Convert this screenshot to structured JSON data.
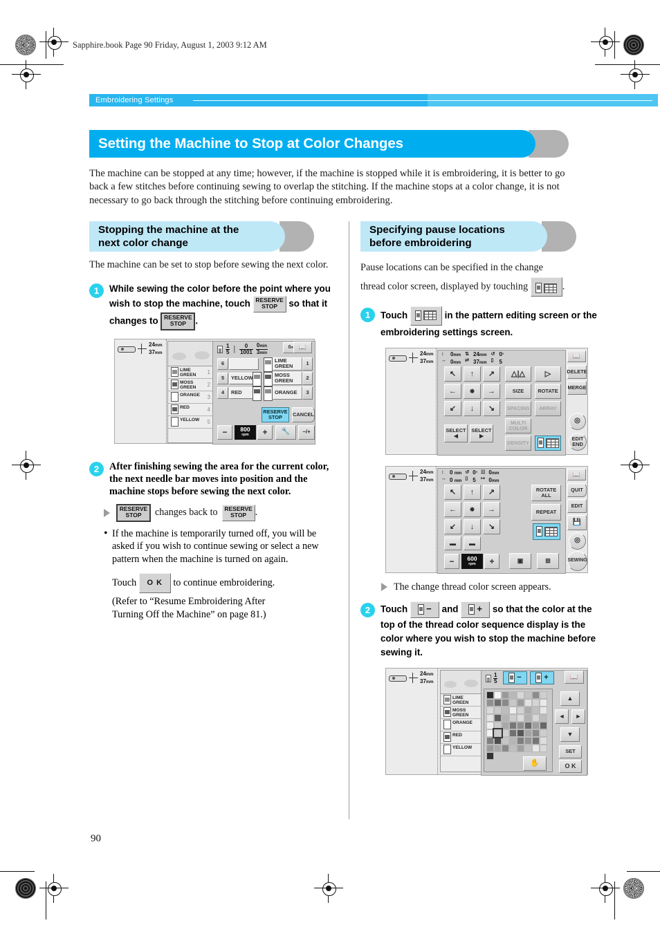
{
  "header": {
    "book_line": "Sapphire.book  Page 90  Friday, August 1, 2003  9:12 AM",
    "running_head": "Embroidering Settings",
    "title": "Setting the Machine to Stop at Color Changes"
  },
  "intro": "The machine can be stopped at any time; however, if the machine is stopped while it is embroidering, it is better to go back a few stitches before continuing sewing to overlap the stitching. If the machine stops at a color change, it is not necessary to go back through the stitching before continuing embroidering.",
  "page_number": "90",
  "left_column": {
    "subhead_line1": "Stopping the machine at the",
    "subhead_line2": "next color change",
    "lead": "The machine can be set to stop before sewing the next color.",
    "step1": {
      "number": "1",
      "text_part1": "While sewing the color before the point where you wish to stop the machine, touch",
      "key_a_line1": "RESERVE",
      "key_a_line2": "STOP",
      "text_part2": "so that it changes to",
      "key_b_line1": "RESERVE",
      "key_b_line2": "STOP",
      "text_part3": "."
    },
    "step2": {
      "number": "2",
      "text": "After finishing sewing the area for the current color, the next needle bar moves into position and the machine stops before sewing the next color.",
      "result_key_line1": "RESERVE",
      "result_key_line2": "STOP",
      "result_text": "changes back to",
      "result_key2_line1": "RESERVE",
      "result_key2_line2": "STOP",
      "result_period": ".",
      "note_bullet": "If the machine is temporarily turned off, you will be asked if you wish to continue sewing or select a new pattern when the machine is turned on again.",
      "touch_prefix": "Touch",
      "ok_label": "O K",
      "touch_suffix": "to continue embroidering.",
      "refer_line1": "(Refer to “Resume Embroidering After",
      "refer_line2": "Turning Off the Machine” on page 81.)"
    },
    "lcd_sewing_screen": {
      "size_w": "24",
      "size_h": "37",
      "unit": "mm",
      "counter_needle_num": "1",
      "counter_needle_den": "5",
      "stitch_current": "0",
      "stitch_total": "1001",
      "time_current": "0",
      "time_total": "3",
      "time_unit": "min",
      "elapsed": "0",
      "elapsed_unit": "min",
      "thread_list": [
        {
          "name_l1": "LIME",
          "name_l2": "GREEN",
          "index": "1"
        },
        {
          "name_l1": "MOSS",
          "name_l2": "GREEN",
          "index": "2"
        },
        {
          "name_l1": "ORANGE",
          "name_l2": "",
          "index": "3"
        },
        {
          "name_l1": "RED",
          "name_l2": "",
          "index": "4"
        },
        {
          "name_l1": "YELLOW",
          "name_l2": "",
          "index": "5"
        }
      ],
      "needle_left": [
        {
          "num": "6",
          "color": ""
        },
        {
          "num": "5",
          "color": "YELLOW"
        },
        {
          "num": "4",
          "color": "RED"
        }
      ],
      "needle_right": [
        {
          "color_l1": "LIME",
          "color_l2": "GREEN",
          "num": "1"
        },
        {
          "color_l1": "MOSS",
          "color_l2": "GREEN",
          "num": "2"
        },
        {
          "color_l1": "ORANGE",
          "color_l2": "",
          "num": "3"
        }
      ],
      "reserve_stop_l1": "RESERVE",
      "reserve_stop_l2": "STOP",
      "cancel": "CANCEL",
      "speed_minus": "−",
      "speed_value": "800",
      "speed_unit": "rpm",
      "speed_plus": "+",
      "needle_plus_minus": "−/+"
    }
  },
  "right_column": {
    "subhead_line1": "Specifying pause locations",
    "subhead_line2": "before embroidering",
    "lead_part1": "Pause locations can be specified in the change",
    "lead_part2": "thread color screen, displayed by touching",
    "lead_period": ".",
    "step1": {
      "number": "1",
      "text_prefix": "Touch",
      "text_suffix": "in the pattern editing screen or the embroidering settings screen."
    },
    "result_text": "The change thread color screen appears.",
    "step2": {
      "number": "2",
      "text_prefix": "Touch",
      "key_minus": "−",
      "text_and": "and",
      "key_plus": "+",
      "text_suffix": "so that the color at the top of the thread color sequence display is the color where you wish to stop the machine before sewing it."
    },
    "lcd_edit_screen": {
      "size_w": "24",
      "size_h": "37",
      "unit": "mm",
      "pos_v": "0",
      "pos_h": "0",
      "pos_unit": "mm",
      "rotate": "0",
      "rotate_unit": "°",
      "needle": "5",
      "buttons": {
        "mirror": "MIRROR",
        "flip": "FLIP",
        "size": "SIZE",
        "rotate": "ROTATE",
        "spacing": "SPACING",
        "array": "ARRAY",
        "multi_color_l1": "MULTI",
        "multi_color_l2": "COLOR",
        "density": "DENSITY",
        "select_left": "SELECT",
        "select_right": "SELECT",
        "delete": "DELETE",
        "merge": "MERGE",
        "edit_end_l1": "EDIT",
        "edit_end_l2": "END"
      }
    },
    "lcd_settings_screen": {
      "size_w": "24",
      "size_h": "37",
      "unit": "mm",
      "pos_v": "0",
      "pos_h": "0",
      "pos_unit": "mm",
      "rotate": "0",
      "rotate_unit": "°",
      "needle": "5",
      "offset_v": "0",
      "offset_h": "0",
      "offset_unit": "mm",
      "buttons": {
        "rotate_all_l1": "ROTATE",
        "rotate_all_l2": "ALL",
        "repeat": "REPEAT",
        "quit": "QUIT",
        "edit": "EDIT",
        "sewing": "SEWING"
      },
      "speed_minus": "−",
      "speed_value": "600",
      "speed_unit": "rpm",
      "speed_plus": "+"
    },
    "lcd_thread_color_screen": {
      "size_w": "24",
      "size_h": "37",
      "unit": "mm",
      "counter_num": "1",
      "counter_den": "5",
      "key_minus": "−",
      "key_plus": "+",
      "thread_list": [
        {
          "name_l1": "LIME",
          "name_l2": "GREEN"
        },
        {
          "name_l1": "MOSS",
          "name_l2": "GREEN"
        },
        {
          "name_l1": "ORANGE",
          "name_l2": ""
        },
        {
          "name_l1": "RED",
          "name_l2": ""
        },
        {
          "name_l1": "YELLOW",
          "name_l2": ""
        }
      ],
      "buttons": {
        "up": "▲",
        "down": "▼",
        "left": "◄",
        "right": "►",
        "set": "SET",
        "ok": "O K"
      }
    }
  },
  "colors": {
    "accent_blue": "#00aeef",
    "runhead_blue": "#29b6ef",
    "subhead_blue": "#bfe8f7",
    "step_circle": "#29d2ec",
    "shadow_grey": "#b2b2b2",
    "lcd_selected": "#7fd7f2"
  }
}
